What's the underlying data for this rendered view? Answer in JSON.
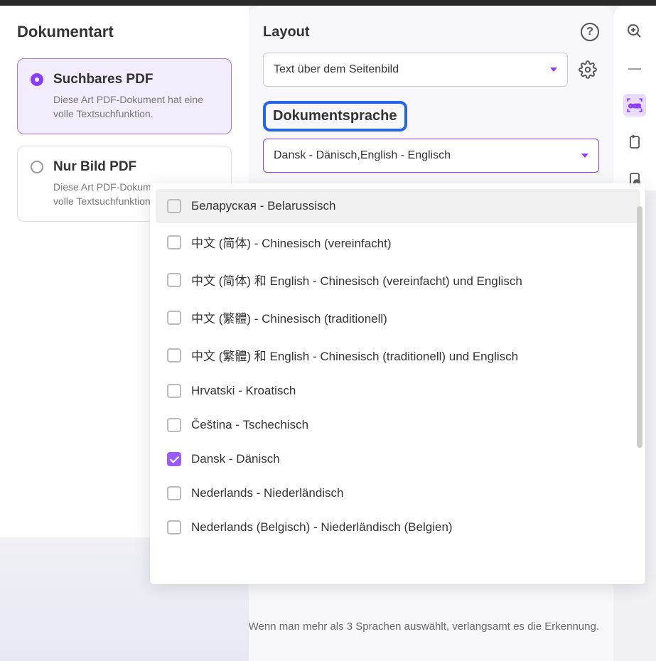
{
  "left": {
    "title": "Dokumentart",
    "options": [
      {
        "title": "Suchbares PDF",
        "desc": "Diese Art PDF-Dokument hat eine volle Textsuchfunktion.",
        "selected": true
      },
      {
        "title": "Nur Bild PDF",
        "desc": "Diese Art PDF-Dokument hat keine volle Textsuchfunktion.",
        "selected": false
      }
    ]
  },
  "right": {
    "layout_label": "Layout",
    "layout_value": "Text über dem Seitenbild",
    "lang_label": "Dokumentsprache",
    "lang_value": "Dansk - Dänisch,English - Englisch"
  },
  "languages": [
    {
      "label": "Беларуская - Belarussisch",
      "checked": false,
      "hover": true
    },
    {
      "label": "中文 (简体) - Chinesisch (vereinfacht)",
      "checked": false
    },
    {
      "label": "中文 (简体) 和 English - Chinesisch (vereinfacht) und Englisch",
      "checked": false
    },
    {
      "label": "中文 (繁體) - Chinesisch (traditionell)",
      "checked": false
    },
    {
      "label": "中文 (繁體) 和 English - Chinesisch (traditionell) und Englisch",
      "checked": false
    },
    {
      "label": "Hrvatski - Kroatisch",
      "checked": false
    },
    {
      "label": "Čeština - Tschechisch",
      "checked": false
    },
    {
      "label": "Dansk - Dänisch",
      "checked": true
    },
    {
      "label": "Nederlands - Niederländisch",
      "checked": false
    },
    {
      "label": "Nederlands (Belgisch) - Niederländisch (Belgien)",
      "checked": false
    }
  ],
  "footer": "Wenn man mehr als 3 Sprachen auswählt, verlangsamt es die Erkennung.",
  "colors": {
    "accent": "#8b3dff",
    "highlight": "#2563eb"
  }
}
